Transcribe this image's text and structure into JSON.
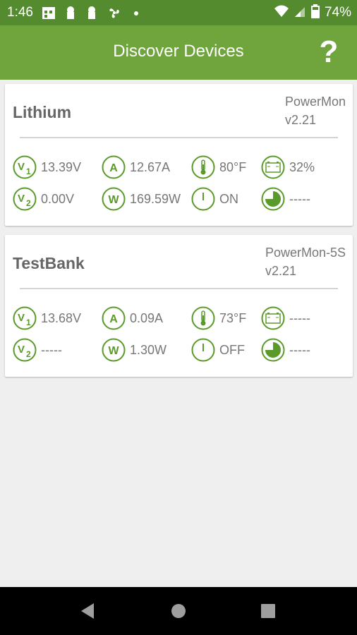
{
  "status_bar": {
    "time": "1:46",
    "battery_percent": "74%",
    "notification_icons": [
      "calendar-icon",
      "keyhole-icon",
      "keyhole-icon",
      "fan-icon",
      "dot-icon"
    ],
    "system_icons": [
      "wifi-icon",
      "signal-icon",
      "battery-icon"
    ]
  },
  "app_bar": {
    "title": "Discover Devices",
    "help_label": "?"
  },
  "devices": [
    {
      "name": "Lithium",
      "model_line1": "PowerMon",
      "model_line2": "v2.21",
      "v1": "13.39V",
      "amps": "12.67A",
      "temp": "80°F",
      "battery": "32%",
      "v2": "0.00V",
      "watts": "169.59W",
      "power": "ON",
      "soc": "-----"
    },
    {
      "name": "TestBank",
      "model_line1": "PowerMon-5S",
      "model_line2": "v2.21",
      "v1": "13.68V",
      "amps": "0.09A",
      "temp": "73°F",
      "battery": "-----",
      "v2": "-----",
      "watts": "1.30W",
      "power": "OFF",
      "soc": "-----"
    }
  ],
  "colors": {
    "status_bar": "#558b2f",
    "app_bar": "#6fa53c",
    "icon_green": "#5a9a2a",
    "text_gray": "#777777"
  }
}
